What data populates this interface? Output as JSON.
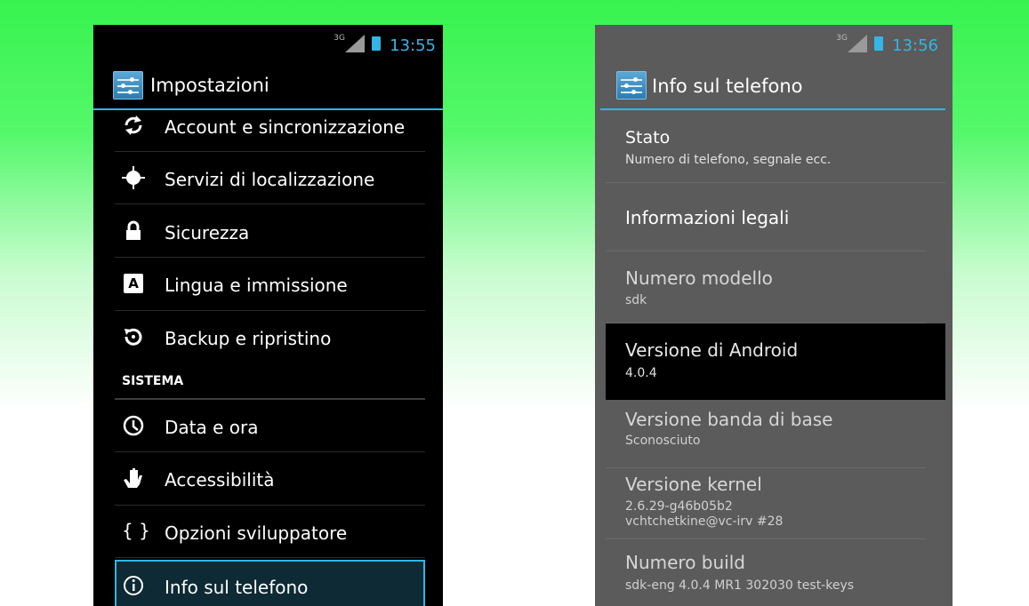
{
  "left_screen": {
    "status": {
      "network": "3G",
      "time": "13:55"
    },
    "title": "Impostazioni",
    "items": [
      {
        "label": "Account e sincronizzazione",
        "icon": "sync-icon"
      },
      {
        "label": "Servizi di localizzazione",
        "icon": "location-icon"
      },
      {
        "label": "Sicurezza",
        "icon": "lock-icon"
      },
      {
        "label": "Lingua e immissione",
        "icon": "keyboard-letter-icon"
      },
      {
        "label": "Backup e ripristino",
        "icon": "restore-icon"
      }
    ],
    "section_header": "SISTEMA",
    "system_items": [
      {
        "label": "Data e ora",
        "icon": "clock-icon"
      },
      {
        "label": "Accessibilità",
        "icon": "hand-icon"
      },
      {
        "label": "Opzioni sviluppatore",
        "icon": "braces-icon",
        "glyph": "{ }"
      },
      {
        "label": "Info sul telefono",
        "icon": "info-icon",
        "selected": true
      }
    ]
  },
  "right_screen": {
    "status": {
      "network": "3G",
      "time": "13:56"
    },
    "title": "Info sul telefono",
    "items": [
      {
        "title": "Stato",
        "subtitle": "Numero di telefono, segnale ecc."
      },
      {
        "title": "Informazioni legali",
        "subtitle": ""
      },
      {
        "title": "Numero modello",
        "subtitle": "sdk"
      },
      {
        "title": "Versione di Android",
        "subtitle": "4.0.4"
      },
      {
        "title": "Versione banda di base",
        "subtitle": "Sconosciuto"
      },
      {
        "title": "Versione kernel",
        "subtitle": "2.6.29-g46b05b2",
        "subtitle2": "vchtchetkine@vc-irv #28"
      },
      {
        "title": "Numero build",
        "subtitle": "sdk-eng 4.0.4 MR1 302030 test-keys"
      }
    ]
  },
  "colors": {
    "accent": "#33b5e5",
    "left_bg": "#000000",
    "right_bg": "#5b5b5b",
    "pressed_bg": "#000000"
  }
}
